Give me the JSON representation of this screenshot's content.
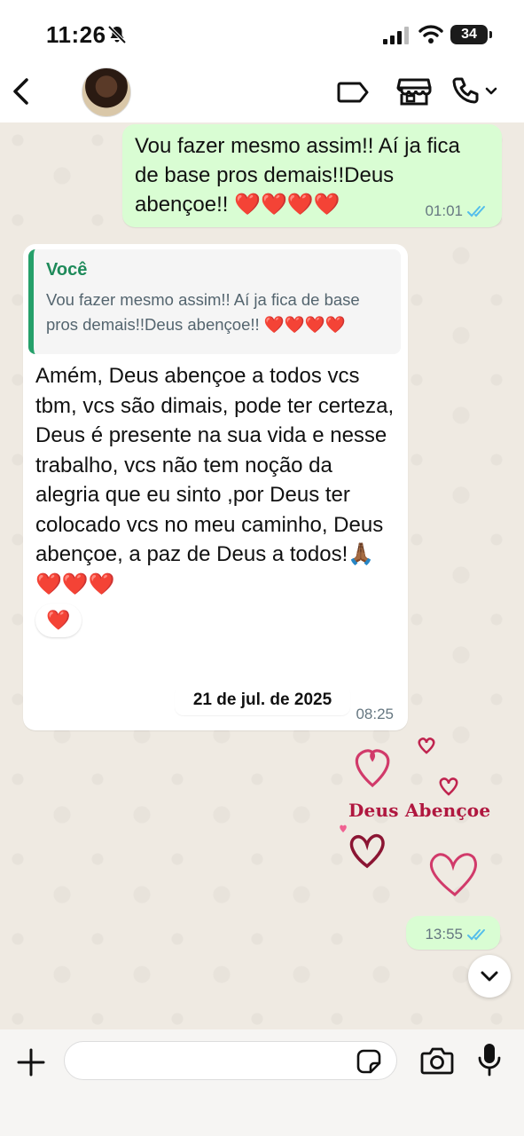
{
  "status_bar": {
    "time": "11:26",
    "battery": "34"
  },
  "header": {
    "back_icon": "chevron-left-icon",
    "avatar": "contact-avatar",
    "actions": [
      "video-call-icon",
      "storefront-icon",
      "phone-call-icon"
    ]
  },
  "messages": [
    {
      "direction": "outgoing",
      "text": "Vou fazer mesmo assim!! Aí ja fica de base pros demais!!Deus abençoe!! ❤️❤️❤️❤️",
      "time": "01:01",
      "status": "read"
    },
    {
      "direction": "incoming",
      "quote": {
        "author": "Você",
        "text": "Vou fazer mesmo assim!! Aí ja fica de base pros demais!!Deus abençoe!! ❤️❤️❤️❤️"
      },
      "text": "Amém,  Deus abençoe a todos vcs tbm, vcs são dimais, pode ter certeza, Deus é presente na sua vida e nesse trabalho, vcs não  tem noção da alegria que eu sinto ,por Deus ter colocado  vcs no meu caminho, Deus abençoe, a paz de Deus a todos!🙏🏾❤️❤️❤️",
      "time": "08:25",
      "reaction": "❤️"
    }
  ],
  "date_separator": "21 de jul. de 2025",
  "sticker": {
    "text": "Deus Abençoe",
    "time": "13:55",
    "status": "read",
    "accent_color": "#b0173f"
  },
  "input": {
    "placeholder": "",
    "value": ""
  },
  "colors": {
    "outgoing_bubble": "#d9fdd3",
    "incoming_bubble": "#ffffff",
    "quote_bar": "#25a06a",
    "read_ticks": "#53bdeb",
    "background": "#efeae2"
  }
}
